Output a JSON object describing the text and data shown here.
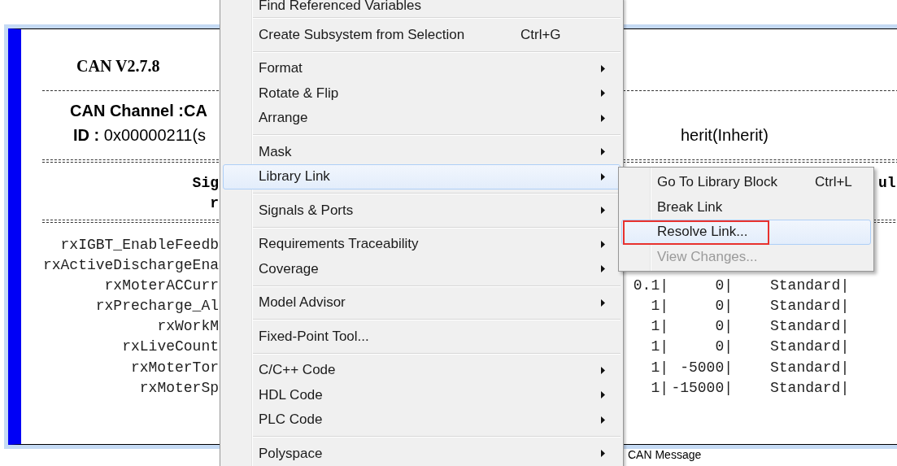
{
  "block": {
    "title": "CAN V2.7.8",
    "channel": "CAN Channel :CA",
    "id_line": "**ID :** 0x00000211(s",
    "id_line_right": "herit(Inherit)",
    "header_left_1": "Sig",
    "header_left_2": "r",
    "header_right_1": "ul",
    "signals": [
      {
        "name": "rxIGBT_EnableFeedb"
      },
      {
        "name": "rxActiveDischargeEna"
      },
      {
        "name": "rxMoterACCurr",
        "column_1": "0.1|",
        "column_2": "0|",
        "column_3": "Standard|"
      },
      {
        "name": "rxPrecharge_Al",
        "column_1": "1|",
        "column_2": "0|",
        "column_3": "Standard|"
      },
      {
        "name": "rxWorkM",
        "column_1": "1|",
        "column_2": "0|",
        "column_3": "Standard|"
      },
      {
        "name": "rxLiveCount",
        "column_1": "1|",
        "column_2": "0|",
        "column_3": "Standard|"
      },
      {
        "name": "rxMoterTor",
        "column_1": "1|",
        "column_2": "-5000|",
        "column_3": "Standard|"
      },
      {
        "name": "rxMoterSp",
        "column_1": "1|",
        "column_2": "-15000|",
        "column_3": "Standard|"
      }
    ],
    "label": "CAN Message"
  },
  "context_menu": {
    "items": [
      {
        "kind": "item",
        "label": "Find Referenced Variables",
        "submenu": false,
        "selected": false
      },
      {
        "kind": "separator"
      },
      {
        "kind": "item",
        "label": "Create Subsystem from Selection",
        "shortcut": "Ctrl+G",
        "submenu": false,
        "selected": false
      },
      {
        "kind": "separator"
      },
      {
        "kind": "item",
        "label": "Format",
        "submenu": true,
        "selected": false
      },
      {
        "kind": "item",
        "label": "Rotate & Flip",
        "submenu": true,
        "selected": false
      },
      {
        "kind": "item",
        "label": "Arrange",
        "submenu": true,
        "selected": false
      },
      {
        "kind": "separator"
      },
      {
        "kind": "item",
        "label": "Mask",
        "submenu": true,
        "selected": false
      },
      {
        "kind": "item",
        "label": "Library Link",
        "submenu": true,
        "selected": true
      },
      {
        "kind": "separator"
      },
      {
        "kind": "item",
        "label": "Signals & Ports",
        "submenu": true,
        "selected": false
      },
      {
        "kind": "separator"
      },
      {
        "kind": "item",
        "label": "Requirements Traceability",
        "submenu": true,
        "selected": false
      },
      {
        "kind": "item",
        "label": "Coverage",
        "submenu": true,
        "selected": false
      },
      {
        "kind": "separator"
      },
      {
        "kind": "item",
        "label": "Model Advisor",
        "submenu": true,
        "selected": false
      },
      {
        "kind": "separator"
      },
      {
        "kind": "item",
        "label": "Fixed-Point Tool...",
        "submenu": false,
        "selected": false
      },
      {
        "kind": "separator"
      },
      {
        "kind": "item",
        "label": "C/C++ Code",
        "submenu": true,
        "selected": false
      },
      {
        "kind": "item",
        "label": "HDL Code",
        "submenu": true,
        "selected": false
      },
      {
        "kind": "item",
        "label": "PLC Code",
        "submenu": true,
        "selected": false
      },
      {
        "kind": "separator"
      },
      {
        "kind": "item",
        "label": "Polyspace",
        "submenu": true,
        "selected": false
      }
    ]
  },
  "submenu": {
    "items": [
      {
        "kind": "item",
        "label": "Go To Library Block",
        "shortcut": "Ctrl+L",
        "selected": false,
        "disabled": false,
        "marked": false
      },
      {
        "kind": "item",
        "label": "Break Link",
        "selected": false,
        "disabled": false,
        "marked": false
      },
      {
        "kind": "item",
        "label": "Resolve Link...",
        "selected": true,
        "disabled": false,
        "marked": true
      },
      {
        "kind": "item",
        "label": "View Changes...",
        "selected": false,
        "disabled": true,
        "marked": false
      }
    ]
  }
}
